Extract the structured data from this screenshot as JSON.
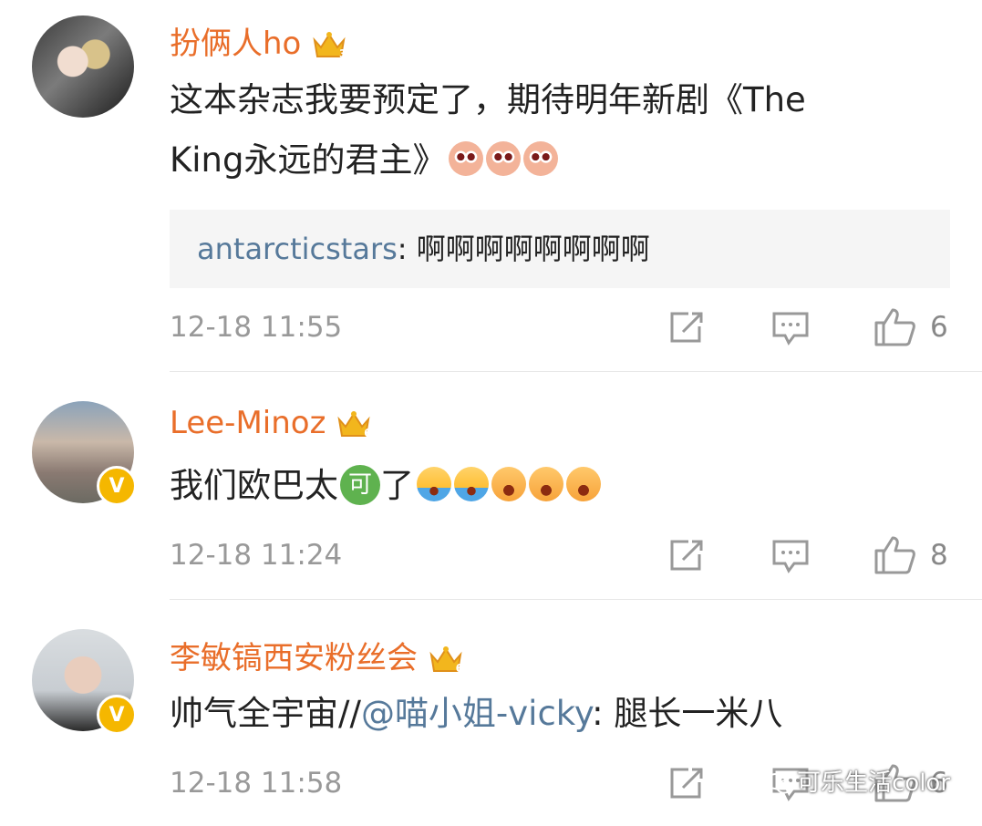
{
  "comments": [
    {
      "username": "扮俩人ho",
      "level": "3",
      "text_parts": [
        "这本杂志我要预定了，期待明年新剧《The",
        "King永远的君主》"
      ],
      "emojis": [
        "ghost-emoji",
        "ghost-emoji",
        "ghost-emoji"
      ],
      "reply": {
        "name": "antarcticstars",
        "text": "啊啊啊啊啊啊啊啊"
      },
      "time": "12-18 11:55",
      "likes": "6",
      "verified": false
    },
    {
      "username": "Lee-Minoz",
      "level": "6",
      "text": "我们欧巴太",
      "ke": "可",
      "after_ke": "了",
      "emojis": [
        "crying-emoji",
        "crying-emoji",
        "angry-emoji",
        "angry-emoji",
        "angry-emoji"
      ],
      "time": "12-18 11:24",
      "likes": "8",
      "verified": true
    },
    {
      "username": "李敏镐西安粉丝会",
      "level": "6",
      "text_before": "帅气全宇宙//",
      "mention": "@喵小姐-vicky",
      "text_after": ": 腿长一米八",
      "time": "12-18 11:58",
      "likes": "6",
      "verified": true
    }
  ],
  "verified_badge": "V",
  "watermark": "可乐生活color",
  "colors": {
    "username": "#e96e2a",
    "mention": "#56799a",
    "badge": "#f5b700"
  }
}
